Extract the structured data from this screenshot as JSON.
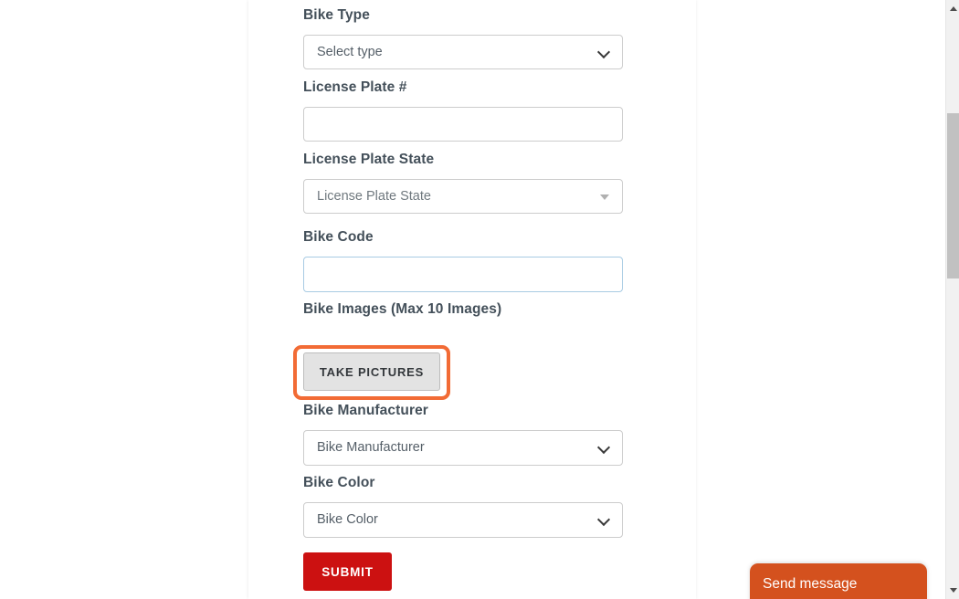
{
  "form": {
    "fields": [
      {
        "label": "Bike Type",
        "control": "native-select",
        "value": "Select type",
        "name": "bike-type"
      },
      {
        "label": "License Plate #",
        "control": "text-input",
        "value": "",
        "name": "license-plate-number"
      },
      {
        "label": "License Plate State",
        "control": "fake-select",
        "value": "License Plate State",
        "name": "license-plate-state"
      },
      {
        "label": "Bike Code",
        "control": "text-input",
        "value": "",
        "name": "bike-code"
      },
      {
        "label": "Bike Images (Max 10 Images)",
        "control": "file-button",
        "value": "TAKE PICTURES",
        "name": "bike-images"
      },
      {
        "label": "Bike Manufacturer",
        "control": "native-select",
        "value": "Bike Manufacturer",
        "name": "bike-manufacturer"
      },
      {
        "label": "Bike Color",
        "control": "native-select",
        "value": "Bike Color",
        "name": "bike-color"
      }
    ],
    "submit_label": "SUBMIT",
    "take_pictures_label": "TAKE PICTURES"
  },
  "chat": {
    "label": "Send message"
  },
  "colors": {
    "highlight_ring": "#f26b35",
    "submit_red": "#cc1111",
    "chat_orange": "#d4511e",
    "label_gray": "#44505a",
    "blue_border": "#a8cbe3",
    "button_gray": "#e3e3e3"
  },
  "scrollbar": {
    "up_arrow": "scroll-up-arrow",
    "down_arrow": "scroll-down-arrow"
  }
}
